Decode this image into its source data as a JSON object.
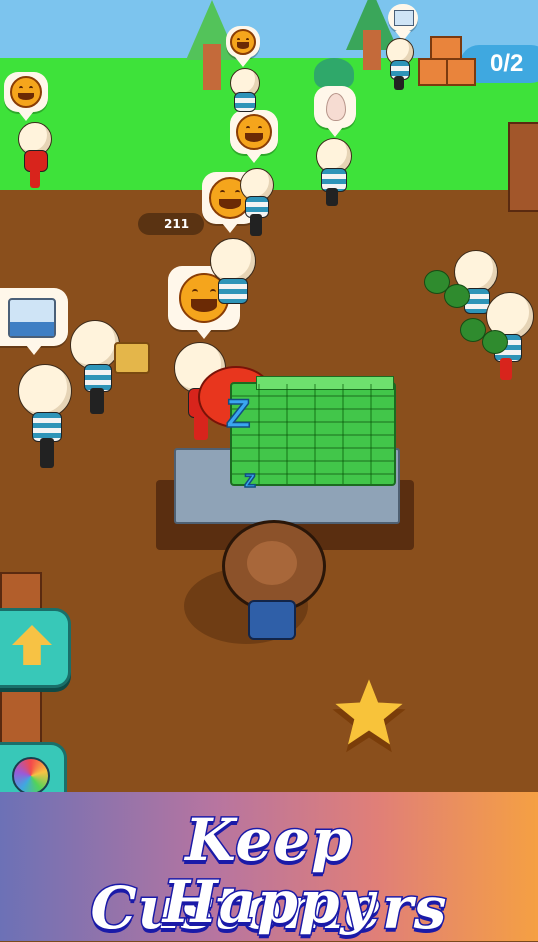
{
  "hud": {
    "delivery_counter": "0/2",
    "delivery_icon": "boxes-icon",
    "level_badge": "211"
  },
  "customers_bubbles": [
    "smiley-face-icon",
    "smiley-face-icon",
    "smiley-face-icon",
    "smiley-face-icon",
    "smiley-face-icon",
    "smiley-face-icon",
    "egg-icon",
    "milk-carton-icon",
    "milk-carton-icon"
  ],
  "side_buttons": [
    "arrow-up-icon",
    "color-wheel-icon"
  ],
  "banner": {
    "line1": "Keep Customers",
    "line2": "Happy"
  },
  "colors": {
    "grass": "#3ee23a",
    "ground": "#8a4f1c",
    "cash": "#42c64a",
    "button_teal": "#38c8b8",
    "banner_text_outline": "#1a1aa8"
  }
}
